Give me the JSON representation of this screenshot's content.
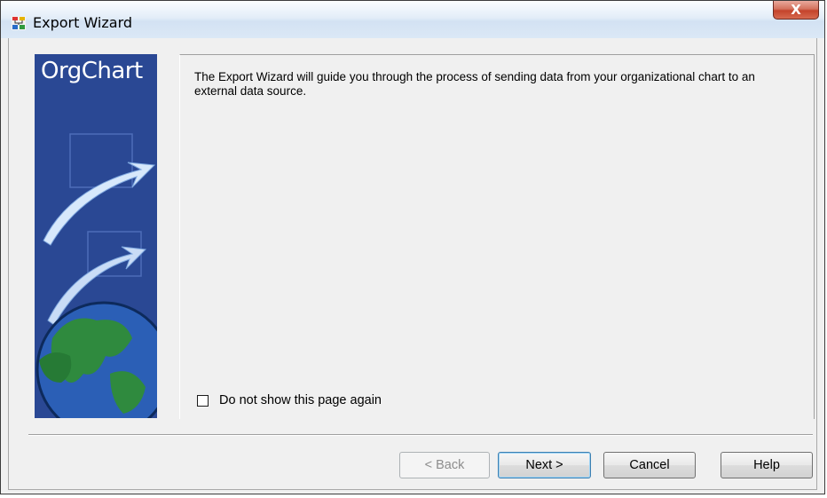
{
  "window": {
    "title": "Export Wizard",
    "close_glyph": "X"
  },
  "banner": {
    "title": "OrgChart"
  },
  "page": {
    "intro": "The Export Wizard will guide you through the process of sending data from your organizational chart to an external data source.",
    "checkbox_label": "Do not show this page again",
    "checkbox_checked": false
  },
  "buttons": {
    "back": "< Back",
    "next": "Next >",
    "cancel": "Cancel",
    "help": "Help"
  },
  "colors": {
    "banner_blue": "#2c4a96",
    "globe_green": "#2f8a3e",
    "close_red": "#c4432b"
  },
  "icons": [
    "orgchart-app-icon",
    "close-icon",
    "arrow-graphic",
    "globe-graphic"
  ]
}
